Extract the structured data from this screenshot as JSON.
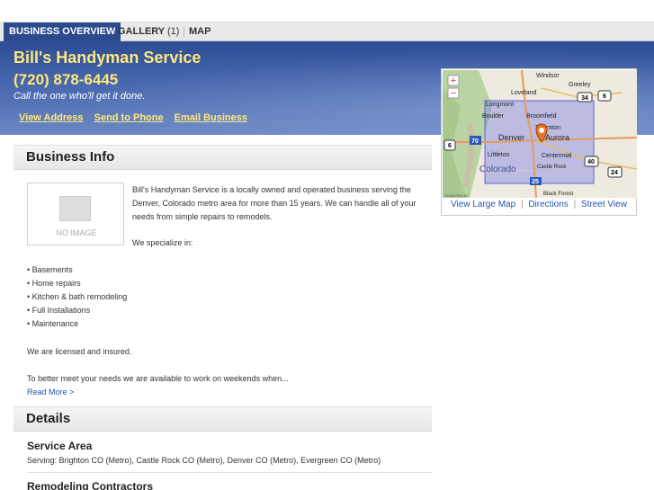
{
  "tabs": [
    {
      "label": "BUSINESS OVERVIEW"
    },
    {
      "label": "GALLERY",
      "count": "(1)"
    },
    {
      "label": "MAP"
    }
  ],
  "header": {
    "name": "Bill's Handyman Service",
    "phone": "(720) 878-6445",
    "tagline": "Call the one who'll get it done.",
    "links": [
      "View Address",
      "Send to Phone",
      "Email Business"
    ]
  },
  "map": {
    "labels": {
      "windsor": "Windsor",
      "greeley": "Greeley",
      "loveland": "Loveland",
      "longmont": "Longmont",
      "boulder": "Boulder",
      "broomfield": "Broomfield",
      "thornton": "Thornton",
      "denver": "Denver",
      "aurora": "Aurora",
      "littleton": "Littleton",
      "centennial": "Centennial",
      "colorado": "Colorado",
      "castle_rock": "Castle Rock",
      "black_forest": "Black Forest",
      "powered_by": "POWERED BY"
    },
    "shields": {
      "s34": "34",
      "s6a": "6",
      "s6b": "6",
      "s70": "70",
      "s40": "40",
      "s24": "24",
      "s25": "25"
    },
    "zoom_in": "+",
    "zoom_out": "−",
    "links": {
      "large": "View Large Map",
      "directions": "Directions",
      "street": "Street View"
    },
    "sep": "|"
  },
  "business_info": {
    "heading": "Business Info",
    "no_image": "NO IMAGE",
    "description": "Bill's Handyman Service is a locally owned and operated business serving the Denver, Colorado metro area for more than 15 years. We can handle all of your needs from simple repairs to remodels.",
    "specialize": "We specialize in:",
    "services": [
      "• Basements",
      "• Home repairs",
      "• Kitchen & bath remodeling",
      "• Full Installations",
      "• Maintenance"
    ],
    "licensed": "We are licensed and insured.",
    "weekends": "To better meet your needs we are available to work on weekends when...",
    "read_more": "Read More >"
  },
  "details": {
    "heading": "Details",
    "service_area_title": "Service Area",
    "service_area_text": "Serving: Brighton CO (Metro), Castle Rock CO (Metro), Denver CO (Metro), Evergreen CO (Metro)",
    "remodeling_title": "Remodeling Contractors"
  },
  "colors": {
    "brand_blue": "#2c4a8e",
    "header_text": "#ffe87a",
    "link": "#2255aa"
  }
}
